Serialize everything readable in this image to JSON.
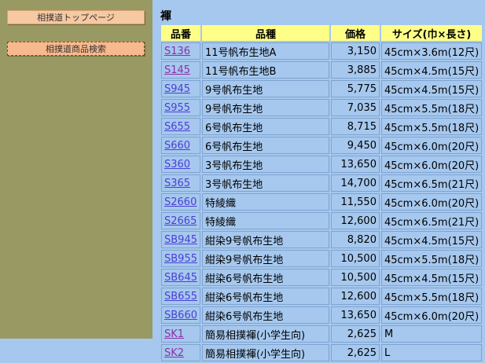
{
  "sidebar": {
    "buttons": [
      {
        "label": "相撲道トップページ"
      },
      {
        "label": "相撲道商品検索"
      }
    ]
  },
  "main": {
    "title": "褌",
    "columns": [
      "品番",
      "品種",
      "価格",
      "サイズ(巾×長さ)"
    ],
    "rows": [
      {
        "code": "S136",
        "type": "11号帆布生地A",
        "price": "3,150",
        "size": "45cm×3.6m(12尺)",
        "visited": true
      },
      {
        "code": "S145",
        "type": "11号帆布生地B",
        "price": "3,885",
        "size": "45cm×4.5m(15尺)",
        "visited": true
      },
      {
        "code": "S945",
        "type": "9号帆布生地",
        "price": "5,775",
        "size": "45cm×4.5m(15尺)",
        "visited": false
      },
      {
        "code": "S955",
        "type": "9号帆布生地",
        "price": "7,035",
        "size": "45cm×5.5m(18尺)",
        "visited": false
      },
      {
        "code": "S655",
        "type": "6号帆布生地",
        "price": "8,715",
        "size": "45cm×5.5m(18尺)",
        "visited": false
      },
      {
        "code": "S660",
        "type": "6号帆布生地",
        "price": "9,450",
        "size": "45cm×6.0m(20尺)",
        "visited": false
      },
      {
        "code": "S360",
        "type": "3号帆布生地",
        "price": "13,650",
        "size": "45cm×6.0m(20尺)",
        "visited": false
      },
      {
        "code": "S365",
        "type": "3号帆布生地",
        "price": "14,700",
        "size": "45cm×6.5m(21尺)",
        "visited": false
      },
      {
        "code": "S2660",
        "type": "特綾織",
        "price": "11,550",
        "size": "45cm×6.0m(20尺)",
        "visited": false
      },
      {
        "code": "S2665",
        "type": "特綾織",
        "price": "12,600",
        "size": "45cm×6.5m(21尺)",
        "visited": false
      },
      {
        "code": "SB945",
        "type": "紺染9号帆布生地",
        "price": "8,820",
        "size": "45cm×4.5m(15尺)",
        "visited": false
      },
      {
        "code": "SB955",
        "type": "紺染9号帆布生地",
        "price": "10,500",
        "size": "45cm×5.5m(18尺)",
        "visited": false
      },
      {
        "code": "SB645",
        "type": "紺染6号帆布生地",
        "price": "10,500",
        "size": "45cm×4.5m(15尺)",
        "visited": false
      },
      {
        "code": "SB655",
        "type": "紺染6号帆布生地",
        "price": "12,600",
        "size": "45cm×5.5m(18尺)",
        "visited": false
      },
      {
        "code": "SB660",
        "type": "紺染6号帆布生地",
        "price": "13,650",
        "size": "45cm×6.0m(20尺)",
        "visited": false
      },
      {
        "code": "SK1",
        "type": "簡易相撲褌(小学生向)",
        "price": "2,625",
        "size": "M",
        "visited": true
      },
      {
        "code": "SK2",
        "type": "簡易相撲褌(小学生向)",
        "price": "2,625",
        "size": "L",
        "visited": true
      }
    ]
  }
}
